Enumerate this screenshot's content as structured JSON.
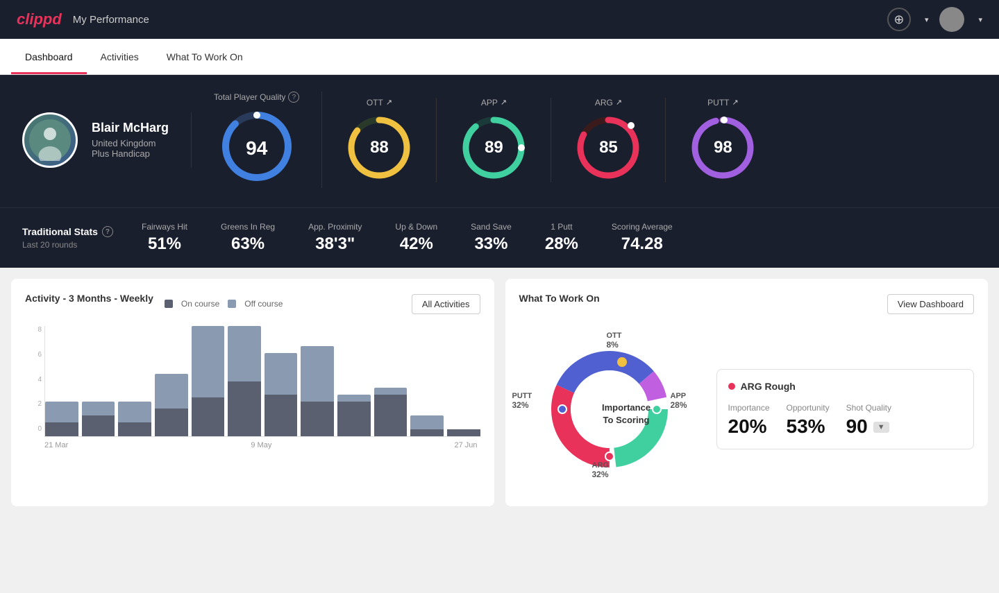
{
  "header": {
    "logo": "clippd",
    "title": "My Performance",
    "add_icon": "+",
    "chevron": "▾"
  },
  "nav": {
    "tabs": [
      {
        "label": "Dashboard",
        "active": true
      },
      {
        "label": "Activities",
        "active": false
      },
      {
        "label": "What To Work On",
        "active": false
      }
    ]
  },
  "player": {
    "name": "Blair McHarg",
    "country": "United Kingdom",
    "handicap": "Plus Handicap"
  },
  "scores": {
    "total_label": "Total Player Quality",
    "total_value": "94",
    "categories": [
      {
        "label": "OTT",
        "value": "88",
        "color": "#f0c040"
      },
      {
        "label": "APP",
        "value": "89",
        "color": "#40d0a0"
      },
      {
        "label": "ARG",
        "value": "85",
        "color": "#e8325a"
      },
      {
        "label": "PUTT",
        "value": "98",
        "color": "#a060e0"
      }
    ]
  },
  "traditional_stats": {
    "title": "Traditional Stats",
    "subtitle": "Last 20 rounds",
    "stats": [
      {
        "label": "Fairways Hit",
        "value": "51%"
      },
      {
        "label": "Greens In Reg",
        "value": "63%"
      },
      {
        "label": "App. Proximity",
        "value": "38'3\""
      },
      {
        "label": "Up & Down",
        "value": "42%"
      },
      {
        "label": "Sand Save",
        "value": "33%"
      },
      {
        "label": "1 Putt",
        "value": "28%"
      },
      {
        "label": "Scoring Average",
        "value": "74.28"
      }
    ]
  },
  "activity_chart": {
    "title": "Activity - 3 Months - Weekly",
    "legend": {
      "on_course": "On course",
      "off_course": "Off course"
    },
    "all_activities_btn": "All Activities",
    "y_labels": [
      "0",
      "2",
      "4",
      "6",
      "8"
    ],
    "x_labels": [
      "21 Mar",
      "9 May",
      "27 Jun"
    ],
    "bars": [
      {
        "on": 1,
        "off": 1.5
      },
      {
        "on": 1.5,
        "off": 1
      },
      {
        "on": 1,
        "off": 1.5
      },
      {
        "on": 2,
        "off": 2.5
      },
      {
        "on": 3,
        "off": 5.5
      },
      {
        "on": 4,
        "off": 4
      },
      {
        "on": 3,
        "off": 3
      },
      {
        "on": 2.5,
        "off": 4
      },
      {
        "on": 2.5,
        "off": 0.5
      },
      {
        "on": 3,
        "off": 0.5
      },
      {
        "on": 0.5,
        "off": 1
      },
      {
        "on": 0.5,
        "off": 0
      }
    ]
  },
  "what_to_work_on": {
    "title": "What To Work On",
    "view_dashboard_btn": "View Dashboard",
    "donut_center": "Importance\nTo Scoring",
    "segments": [
      {
        "label": "OTT",
        "value": "8%",
        "color": "#a060e0",
        "position": {
          "top": "5%",
          "left": "54%"
        }
      },
      {
        "label": "APP",
        "value": "28%",
        "color": "#40d0a0",
        "position": {
          "top": "50%",
          "left": "93%"
        }
      },
      {
        "label": "ARG",
        "value": "32%",
        "color": "#e8325a",
        "position": {
          "top": "90%",
          "left": "50%"
        }
      },
      {
        "label": "PUTT",
        "value": "32%",
        "color": "#5060d0",
        "position": {
          "top": "45%",
          "left": "-10%"
        }
      }
    ],
    "card": {
      "title": "ARG Rough",
      "dot_color": "#e8325a",
      "stats": [
        {
          "label": "Importance",
          "value": "20%"
        },
        {
          "label": "Opportunity",
          "value": "53%"
        },
        {
          "label": "Shot Quality",
          "value": "90",
          "badge": "▼"
        }
      ]
    }
  }
}
